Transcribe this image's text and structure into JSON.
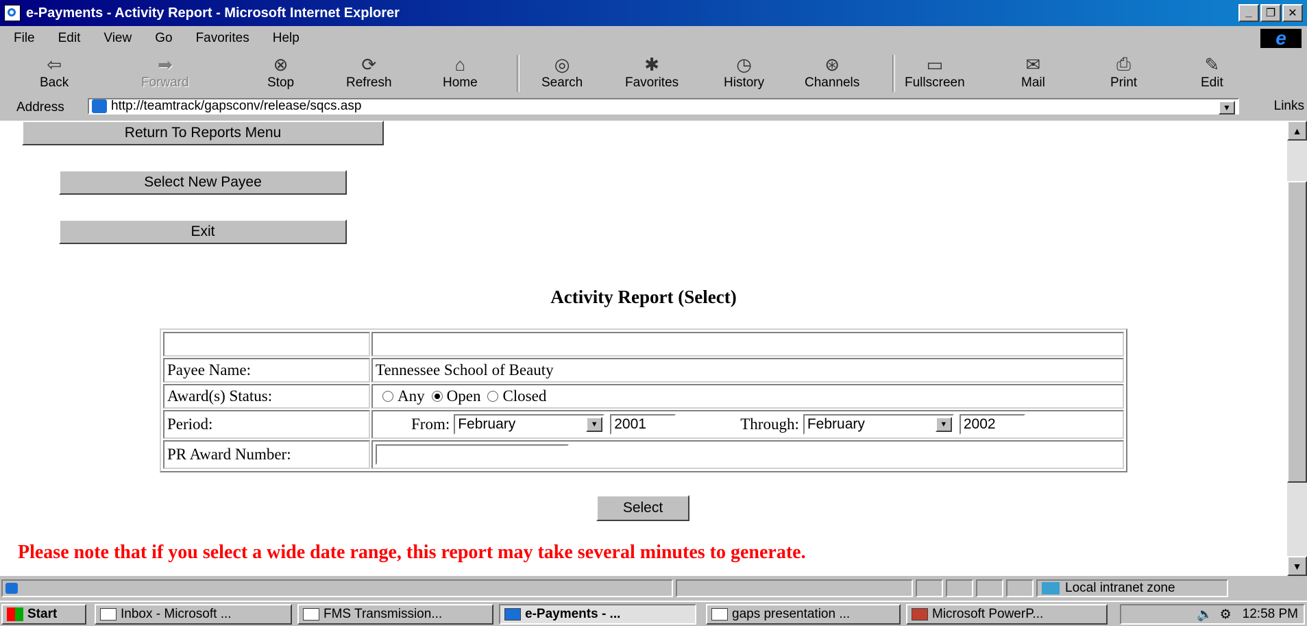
{
  "window": {
    "title": "e-Payments - Activity Report - Microsoft Internet Explorer",
    "buttons": [
      "_",
      "▫",
      "X"
    ]
  },
  "menu": [
    "File",
    "Edit",
    "View",
    "Go",
    "Favorites",
    "Help"
  ],
  "toolbar": [
    {
      "label": "Back",
      "icon": "back-arrow-icon",
      "glyph": "⇦"
    },
    {
      "label": "Forward",
      "icon": "forward-arrow-icon",
      "glyph": "➡"
    },
    {
      "label": "Stop",
      "icon": "stop-icon",
      "glyph": "⊗"
    },
    {
      "label": "Refresh",
      "icon": "refresh-icon",
      "glyph": "⟳"
    },
    {
      "label": "Home",
      "icon": "home-icon",
      "glyph": "⌂"
    },
    {
      "label": "Search",
      "icon": "search-icon",
      "glyph": "◎"
    },
    {
      "label": "Favorites",
      "icon": "favorites-icon",
      "glyph": "✱"
    },
    {
      "label": "History",
      "icon": "history-icon",
      "glyph": "◷"
    },
    {
      "label": "Channels",
      "icon": "channels-icon",
      "glyph": "⊛"
    },
    {
      "label": "Fullscreen",
      "icon": "fullscreen-icon",
      "glyph": "▭"
    },
    {
      "label": "Mail",
      "icon": "mail-icon",
      "glyph": "✉"
    },
    {
      "label": "Print",
      "icon": "print-icon",
      "glyph": "⎙"
    },
    {
      "label": "Edit",
      "icon": "edit-icon",
      "glyph": "✎"
    }
  ],
  "address": {
    "label": "Address",
    "url": "http://teamtrack/gapsconv/release/sqcs.asp",
    "links_label": "Links"
  },
  "page": {
    "nav_buttons": {
      "return": "Return To Reports Menu",
      "select_payee": "Select New Payee",
      "exit": "Exit"
    },
    "heading": "Activity Report (Select)",
    "form": {
      "payee_label": "Payee Name:",
      "payee_value": "Tennessee School of Beauty",
      "status_label": "Award(s) Status:",
      "status_options": [
        "Any",
        "Open",
        "Closed"
      ],
      "status_selected": "Open",
      "period_label": "Period:",
      "from_label": "From:",
      "from_month": "February",
      "from_year": "2001",
      "through_label": "Through:",
      "through_month": "February",
      "through_year": "2002",
      "award_label": "PR Award Number:",
      "award_value": ""
    },
    "select_button": "Select",
    "note": "Please note that if you select a wide date range, this report may take several minutes to generate."
  },
  "status_bar": {
    "zone": "Local intranet zone"
  },
  "taskbar": {
    "start": "Start",
    "tasks": [
      "Inbox - Microsoft ...",
      "FMS Transmission...",
      "e-Payments - ...",
      "gaps presentation ...",
      "Microsoft PowerP..."
    ],
    "active_task": "e-Payments - ...",
    "clock": "12:58 PM"
  }
}
